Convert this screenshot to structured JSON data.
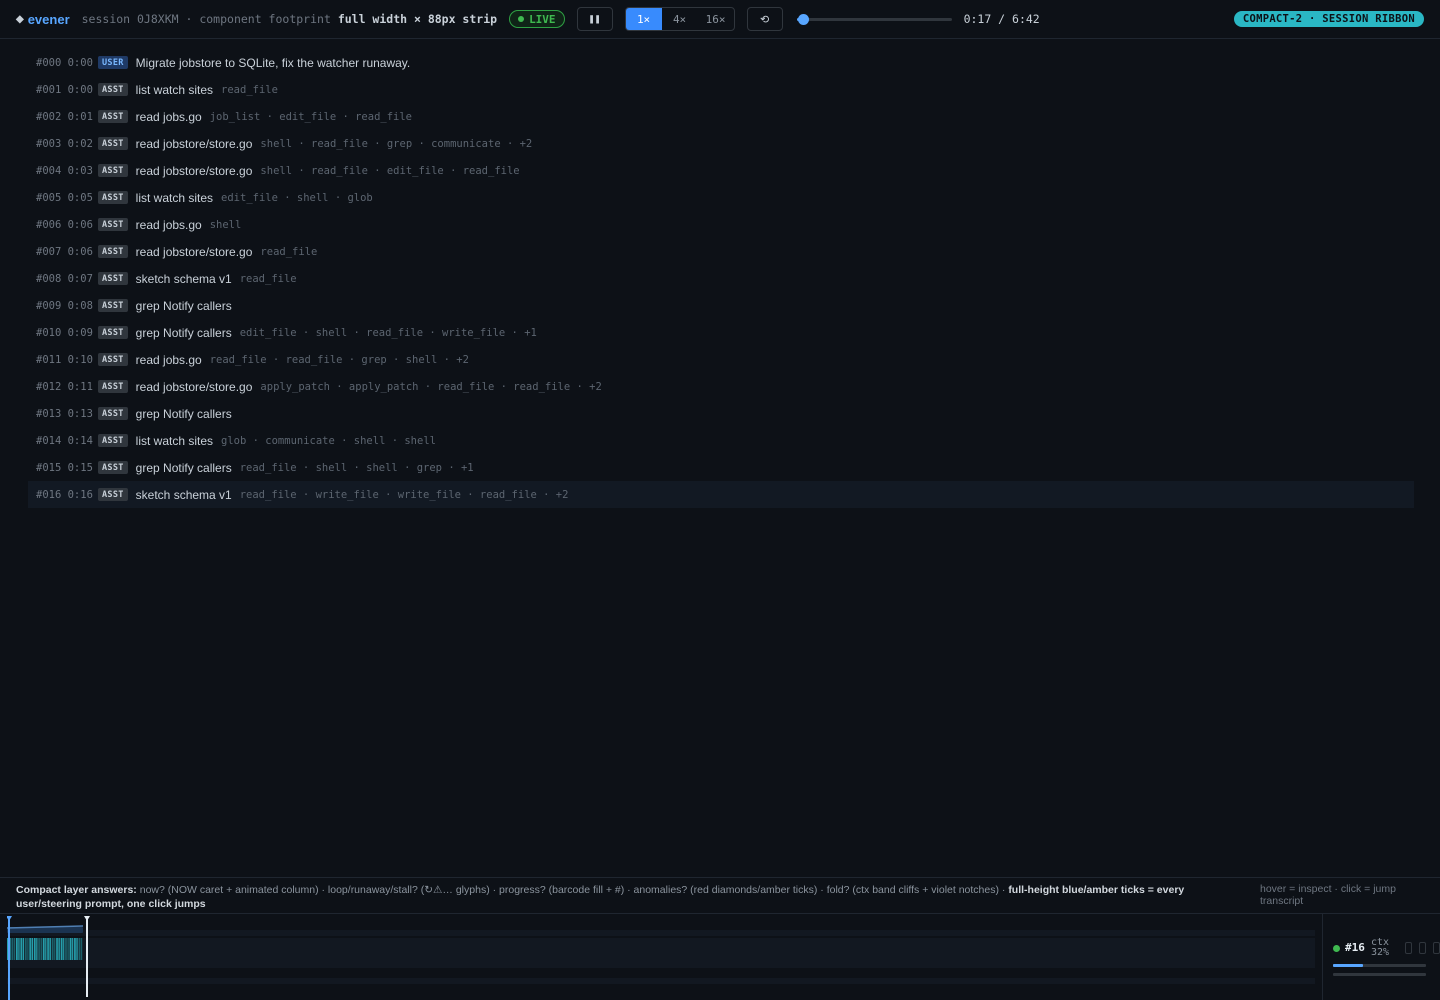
{
  "header": {
    "brand_glyph": "◆",
    "brand": "evener",
    "session": "session 0J8XKM · component footprint",
    "footprint": "full width × 88px strip",
    "live_label": "LIVE",
    "pause_icon": "pause-icon",
    "pause_glyph": "❚❚",
    "speeds": [
      "1×",
      "4×",
      "16×"
    ],
    "active_speed": "1×",
    "reset_glyph": "⟲",
    "time": "0:17 / 6:42",
    "progress": 0.042,
    "badge": "COMPACT-2 · SESSION RIBBON"
  },
  "transcript": {
    "current_index": 16,
    "rows": [
      {
        "idx": "#000 0:00",
        "role": "USER",
        "text": "Migrate jobstore to SQLite, fix the watcher runaway.",
        "tools": ""
      },
      {
        "idx": "#001 0:00",
        "role": "ASST",
        "text": "list watch sites",
        "tools": "read_file"
      },
      {
        "idx": "#002 0:01",
        "role": "ASST",
        "text": "read jobs.go",
        "tools": "job_list · edit_file · read_file"
      },
      {
        "idx": "#003 0:02",
        "role": "ASST",
        "text": "read jobstore/store.go",
        "tools": "shell · read_file · grep · communicate · +2"
      },
      {
        "idx": "#004 0:03",
        "role": "ASST",
        "text": "read jobstore/store.go",
        "tools": "shell · read_file · edit_file · read_file"
      },
      {
        "idx": "#005 0:05",
        "role": "ASST",
        "text": "list watch sites",
        "tools": "edit_file · shell · glob"
      },
      {
        "idx": "#006 0:06",
        "role": "ASST",
        "text": "read jobs.go",
        "tools": "shell"
      },
      {
        "idx": "#007 0:06",
        "role": "ASST",
        "text": "read jobstore/store.go",
        "tools": "read_file"
      },
      {
        "idx": "#008 0:07",
        "role": "ASST",
        "text": "sketch schema v1",
        "tools": "read_file"
      },
      {
        "idx": "#009 0:08",
        "role": "ASST",
        "text": "grep Notify callers",
        "tools": ""
      },
      {
        "idx": "#010 0:09",
        "role": "ASST",
        "text": "grep Notify callers",
        "tools": "edit_file · shell · read_file · write_file · +1"
      },
      {
        "idx": "#011 0:10",
        "role": "ASST",
        "text": "read jobs.go",
        "tools": "read_file · read_file · grep · shell · +2"
      },
      {
        "idx": "#012 0:11",
        "role": "ASST",
        "text": "read jobstore/store.go",
        "tools": "apply_patch · apply_patch · read_file · read_file · +2"
      },
      {
        "idx": "#013 0:13",
        "role": "ASST",
        "text": "grep Notify callers",
        "tools": ""
      },
      {
        "idx": "#014 0:14",
        "role": "ASST",
        "text": "list watch sites",
        "tools": "glob · communicate · shell · shell"
      },
      {
        "idx": "#015 0:15",
        "role": "ASST",
        "text": "grep Notify callers",
        "tools": "read_file · shell · shell · grep · +1"
      },
      {
        "idx": "#016 0:16",
        "role": "ASST",
        "text": "sketch schema v1",
        "tools": "read_file · write_file · write_file · read_file · +2"
      }
    ]
  },
  "legend": {
    "title": "Compact layer answers:",
    "body": " now? (NOW caret + animated column) · loop/runaway/stall? (↻⚠… glyphs) · progress? (barcode fill + #) · anomalies? (red diamonds/amber ticks) · fold? (ctx band cliffs + violet notches) · ",
    "emphasis": "full-height blue/amber ticks = every user/steering prompt, one click jumps",
    "hint": "hover = inspect · click = jump transcript"
  },
  "ribbon": {
    "turn": "#16",
    "ctx_label": "ctx",
    "ctx_value": "32%",
    "ctx_fraction": 0.32,
    "barcode_segments": 17,
    "colors": {
      "accent": "#58a6ff",
      "barcode": "#2ab7c4",
      "barcode_dark": "#1f6f78",
      "live": "#3fb950",
      "now": "#e6edf3"
    }
  }
}
